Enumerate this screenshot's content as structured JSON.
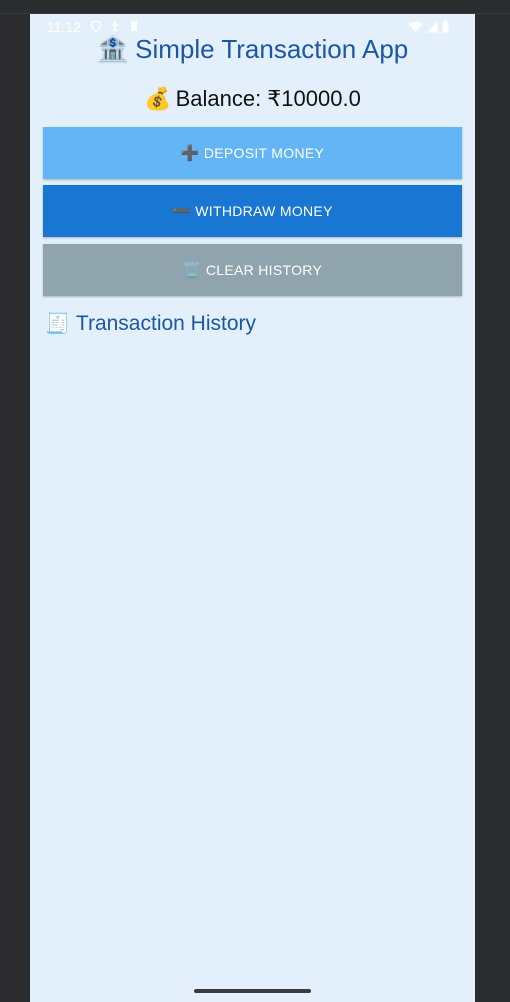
{
  "status_bar": {
    "time": "11:12"
  },
  "app": {
    "title": "Simple Transaction App",
    "title_icon": "bank-icon",
    "balance_text": "Balance: ₹10000.0",
    "balance_icon": "money-bag-icon"
  },
  "buttons": {
    "deposit_label": "DEPOSIT MONEY",
    "deposit_icon": "plus-icon",
    "withdraw_label": "WITHDRAW MONEY",
    "withdraw_icon": "minus-icon",
    "clear_label": "CLEAR HISTORY",
    "clear_icon": "trash-icon"
  },
  "history": {
    "title": "Transaction History",
    "title_icon": "receipt-icon",
    "items": []
  },
  "colors": {
    "background": "#e3f0fb",
    "title": "#1c57a5",
    "deposit": "#64b5f6",
    "withdraw": "#1976d2",
    "clear": "#90a4ae"
  }
}
